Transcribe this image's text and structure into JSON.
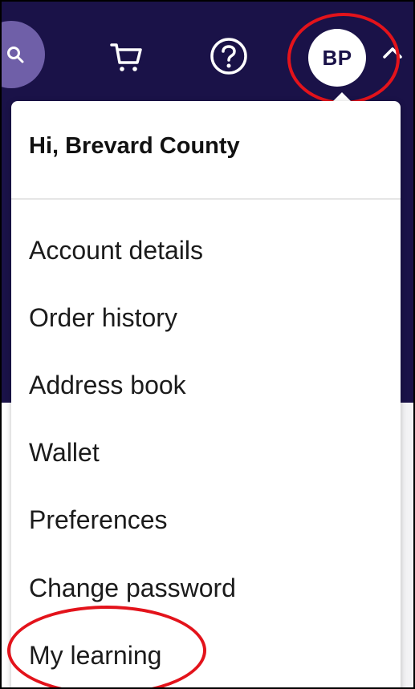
{
  "header": {
    "avatar_initials": "BP",
    "icons": {
      "search": "search-icon",
      "cart": "cart-icon",
      "help": "help-icon",
      "chevron": "chevron-up-icon"
    },
    "colors": {
      "nav_background": "#1a1248",
      "search_bubble": "#6f5fa8",
      "highlight": "#e3131b"
    }
  },
  "dropdown": {
    "greeting": "Hi, Brevard County",
    "items": [
      {
        "label": "Account details"
      },
      {
        "label": "Order history"
      },
      {
        "label": "Address book"
      },
      {
        "label": "Wallet"
      },
      {
        "label": "Preferences"
      },
      {
        "label": "Change password"
      },
      {
        "label": "My learning"
      }
    ]
  }
}
